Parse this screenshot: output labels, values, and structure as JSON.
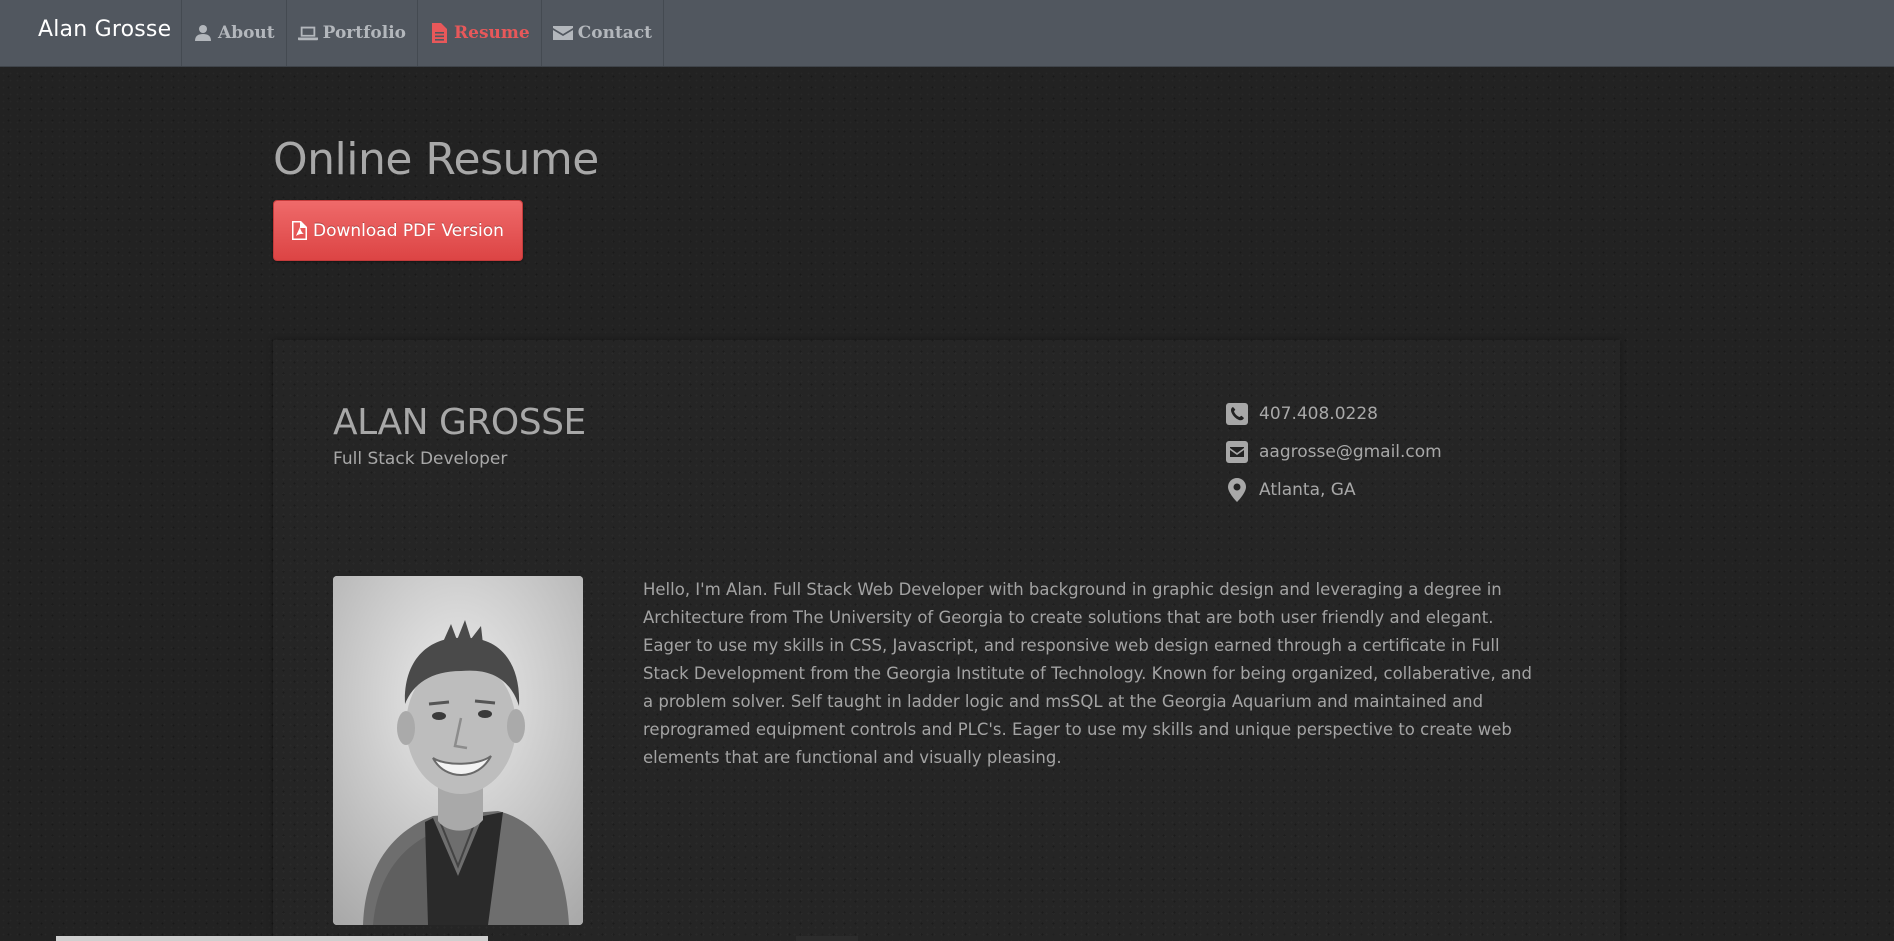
{
  "navbar": {
    "brand": "Alan Grosse",
    "items": [
      {
        "label": "About",
        "icon": "user-icon",
        "active": false
      },
      {
        "label": "Portfolio",
        "icon": "laptop-icon",
        "active": false
      },
      {
        "label": "Resume",
        "icon": "file-icon",
        "active": true
      },
      {
        "label": "Contact",
        "icon": "envelope-icon",
        "active": false
      }
    ]
  },
  "header": {
    "title": "Online Resume",
    "download_label": "Download PDF Version",
    "download_icon": "file-pdf-icon"
  },
  "resume": {
    "name": "ALAN GROSSE",
    "role": "Full Stack Developer",
    "contact": {
      "phone": "407.408.0228",
      "email": "aagrosse@gmail.com",
      "location": "Atlanta, GA"
    },
    "photo_icon": "profile-photo",
    "bio": "Hello, I'm Alan. Full Stack Web Developer with background in graphic design and leveraging a degree in Architecture from The University of Georgia to create solutions that are both user friendly and elegant. Eager to use my skills in CSS, Javascript, and responsive web design earned through a certificate in Full Stack Development from the Georgia Institute of Technology. Known for being organized, collaberative, and a problem solver. Self taught in ladder logic and msSQL at the Georgia Aquarium and maintained and reprogramed equipment controls and PLC's. Eager to use my skills and unique perspective to create web elements that are functional and visually pleasing."
  },
  "colors": {
    "navbar_bg": "#51575f",
    "accent": "#e8585a",
    "page_bg": "#222222",
    "text": "#a8a8a8"
  }
}
